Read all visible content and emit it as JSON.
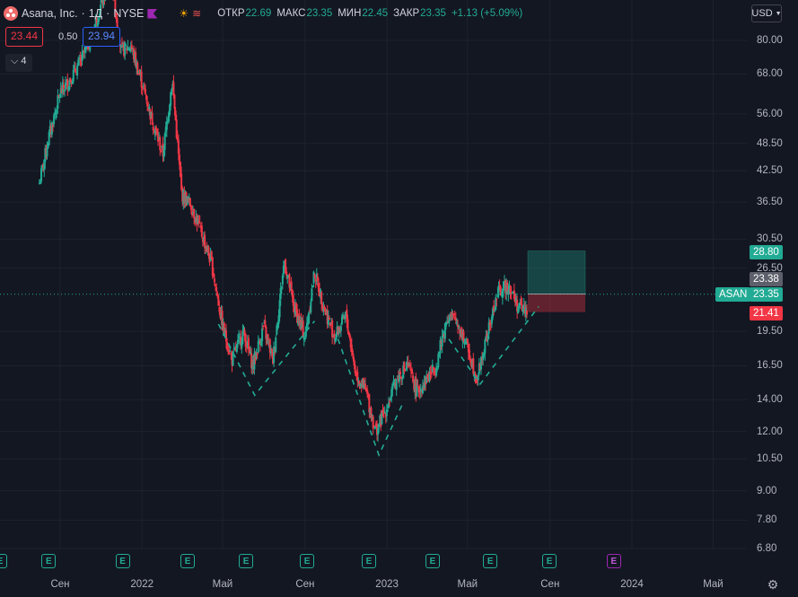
{
  "header": {
    "symbol_name": "Asana, Inc.",
    "interval": "1Д",
    "exchange": "NYSE",
    "ohlc": {
      "open_label": "ОТКР",
      "open_value": "22.69",
      "high_label": "МАКС",
      "high_value": "23.35",
      "low_label": "МИН",
      "low_value": "22.45",
      "close_label": "ЗАКР",
      "close_value": "23.35",
      "change": "+1.13 (+5.09%)"
    },
    "bid": "23.44",
    "spread": "0.50",
    "ask": "23.94",
    "indicator_count": "4",
    "currency": "USD"
  },
  "price_scale": {
    "labels": [
      "80.00",
      "68.00",
      "56.00",
      "48.50",
      "42.50",
      "36.50",
      "30.50",
      "26.50",
      "19.50",
      "16.50",
      "14.00",
      "12.00",
      "10.50",
      "9.00",
      "7.80",
      "6.80"
    ],
    "tags": {
      "target": "28.80",
      "entry": "23.38",
      "symbol": "ASAN",
      "last": "23.35",
      "stop": "21.41"
    },
    "log_scale": true
  },
  "time_scale": {
    "labels": [
      "Сен",
      "2022",
      "Май",
      "Сен",
      "2023",
      "Май",
      "Сен",
      "2024",
      "Май"
    ]
  },
  "earnings_markers": {
    "label": "E",
    "count_past": 9,
    "count_future": 1
  },
  "colors": {
    "up": "#22ab94",
    "down": "#f23645",
    "background": "#131722",
    "pattern": "#22ab94"
  },
  "chart_data": {
    "type": "candlestick",
    "symbol": "ASAN",
    "y_scale": "log",
    "y_range": [
      6.5,
      92
    ],
    "x_range": [
      "2021-08",
      "2024-06"
    ],
    "close_series": [
      [
        "2021-08-01",
        40
      ],
      [
        "2021-08-15",
        50
      ],
      [
        "2021-09-01",
        62
      ],
      [
        "2021-09-15",
        66
      ],
      [
        "2021-10-01",
        72
      ],
      [
        "2021-10-15",
        80
      ],
      [
        "2021-11-01",
        95
      ],
      [
        "2021-11-15",
        110
      ],
      [
        "2021-12-01",
        76
      ],
      [
        "2021-12-15",
        78
      ],
      [
        "2022-01-01",
        65
      ],
      [
        "2022-01-15",
        55
      ],
      [
        "2022-02-01",
        46
      ],
      [
        "2022-02-15",
        66
      ],
      [
        "2022-03-01",
        38
      ],
      [
        "2022-03-15",
        36
      ],
      [
        "2022-04-01",
        31
      ],
      [
        "2022-04-15",
        27
      ],
      [
        "2022-05-01",
        20
      ],
      [
        "2022-05-15",
        17
      ],
      [
        "2022-06-01",
        19.5
      ],
      [
        "2022-06-15",
        16.5
      ],
      [
        "2022-07-01",
        20
      ],
      [
        "2022-07-15",
        17
      ],
      [
        "2022-08-01",
        27.5
      ],
      [
        "2022-08-15",
        22
      ],
      [
        "2022-09-01",
        19
      ],
      [
        "2022-09-15",
        26
      ],
      [
        "2022-10-01",
        21.5
      ],
      [
        "2022-10-15",
        19
      ],
      [
        "2022-11-01",
        21
      ],
      [
        "2022-11-15",
        16
      ],
      [
        "2022-12-01",
        14.5
      ],
      [
        "2022-12-15",
        12
      ],
      [
        "2023-01-01",
        13.5
      ],
      [
        "2023-01-15",
        15.5
      ],
      [
        "2023-02-01",
        16.5
      ],
      [
        "2023-02-15",
        14.5
      ],
      [
        "2023-03-01",
        15.5
      ],
      [
        "2023-03-15",
        16.5
      ],
      [
        "2023-04-01",
        21
      ],
      [
        "2023-04-15",
        20.5
      ],
      [
        "2023-05-01",
        18
      ],
      [
        "2023-05-15",
        15.5
      ],
      [
        "2023-06-01",
        19.5
      ],
      [
        "2023-06-15",
        23.5
      ],
      [
        "2023-07-01",
        24.5
      ],
      [
        "2023-07-15",
        22
      ],
      [
        "2023-08-01",
        21.5
      ],
      [
        "2023-08-15",
        23.35
      ]
    ],
    "pattern": {
      "type": "triple bottom (dashed V lines)",
      "bottoms": [
        [
          "2022-06-15",
          14.5
        ],
        [
          "2022-12-20",
          10.8
        ],
        [
          "2023-05-20",
          15.2
        ]
      ]
    },
    "position": {
      "entry": 23.38,
      "target": 28.8,
      "stop": 21.41
    }
  }
}
